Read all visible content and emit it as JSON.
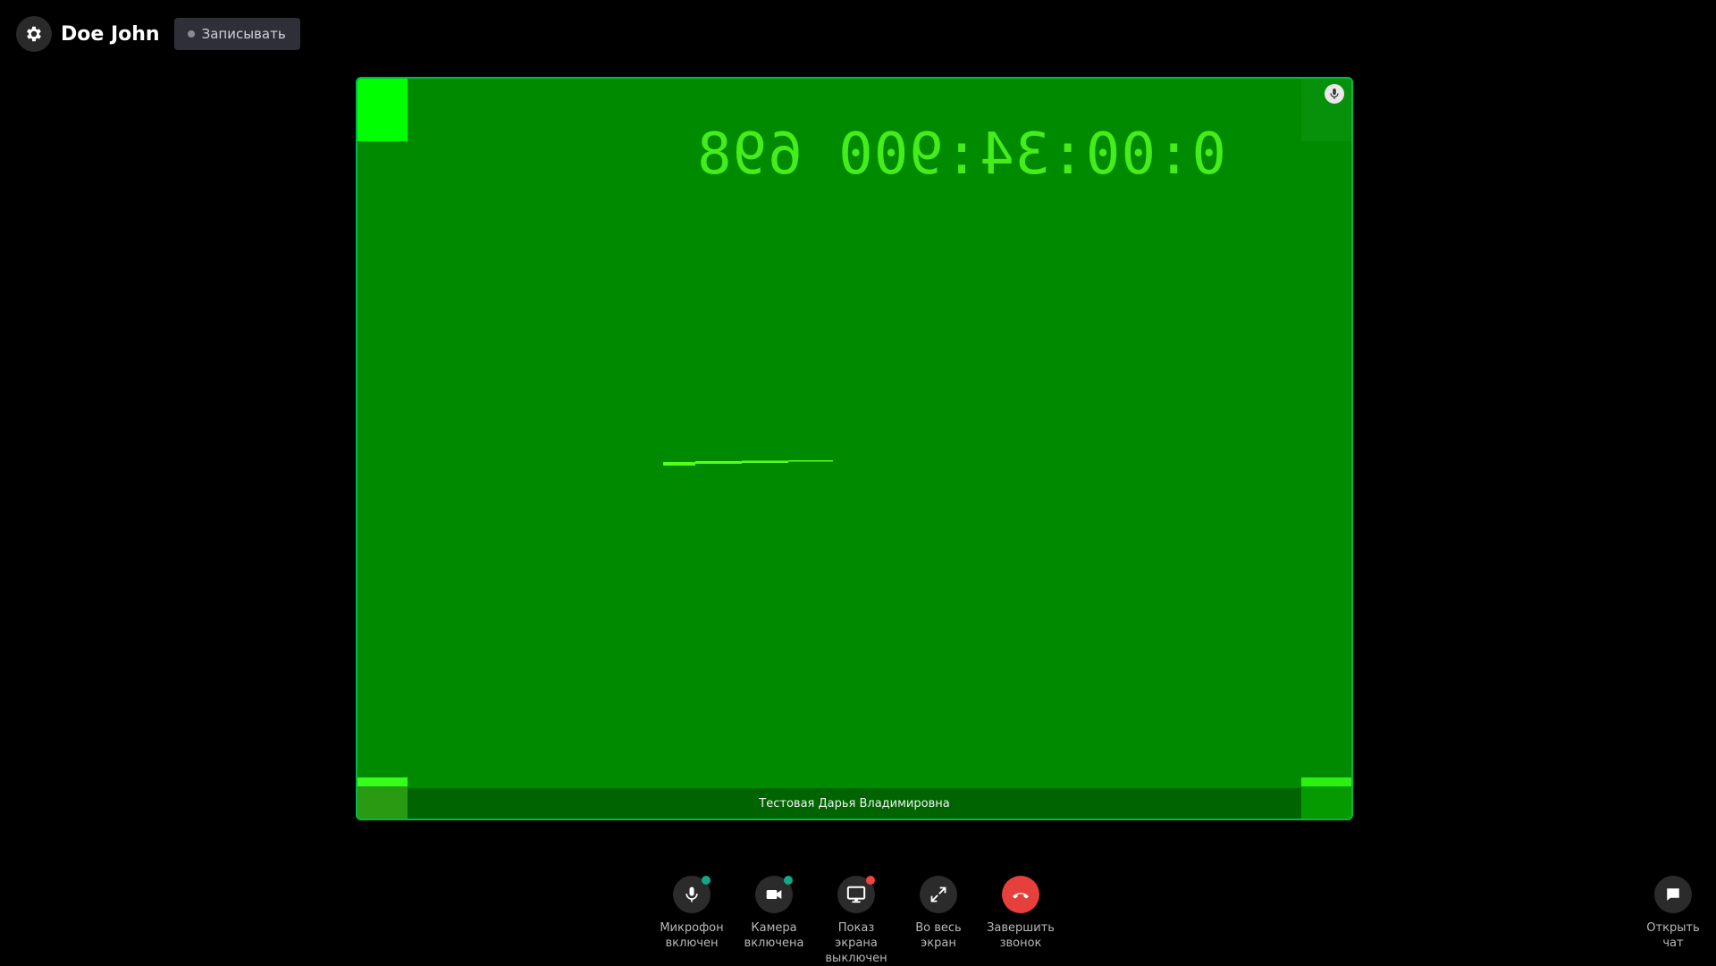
{
  "header": {
    "settings_icon": "gear-icon",
    "user_name": "Doe John",
    "record_label": "Записывать"
  },
  "video": {
    "timecode": "0:00:34:900 698",
    "participant_name": "Тестовая Дарья Владимировна",
    "background_color": "#008a00",
    "mic_icon": "microphone-icon"
  },
  "controls": {
    "mic": {
      "label": "Микрофон\nвключен",
      "icon": "microphone-icon",
      "status_color": "#0fa88a"
    },
    "camera": {
      "label": "Камера\nвключена",
      "icon": "video-camera-icon",
      "status_color": "#0fa88a"
    },
    "screen": {
      "label": "Показ экрана\nвыключен",
      "icon": "monitor-icon",
      "status_color": "#f0453e"
    },
    "fullscreen": {
      "label": "Во весь\nэкран",
      "icon": "expand-icon"
    },
    "end_call": {
      "label": "Завершить\nзвонок",
      "icon": "phone-hangup-icon",
      "color": "#e5403b"
    }
  },
  "chat": {
    "label": "Открыть\nчат",
    "icon": "chat-bubble-icon"
  }
}
